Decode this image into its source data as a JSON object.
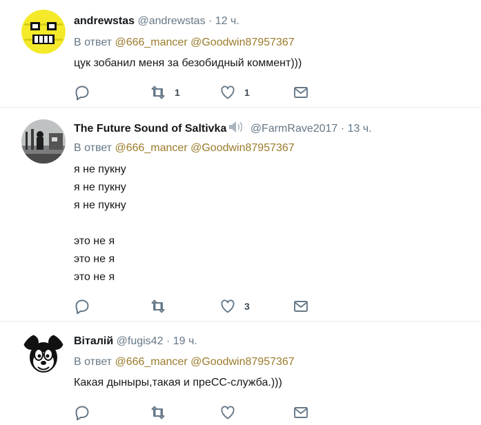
{
  "tweets": [
    {
      "name": "andrewstas",
      "handle": "@andrewstas",
      "time": "12 ч.",
      "reply_prefix": "В ответ",
      "mentions": [
        "@666_mancer",
        "@Goodwin87957367"
      ],
      "text": "цук зобанил меня за безобидный коммент)))",
      "retweets": "1",
      "likes": "1",
      "avatar": "smiley-avatar"
    },
    {
      "name": "The Future Sound of Saltivka",
      "handle": "@FarmRave2017",
      "time": "13 ч.",
      "reply_prefix": "В ответ",
      "mentions": [
        "@666_mancer",
        "@Goodwin87957367"
      ],
      "text": "я не пукну\nя не пукну\nя не пукну\n\nэто не я\nэто не я\nэто не я",
      "retweets": "",
      "likes": "3",
      "avatar": "photo-avatar",
      "name_icon": "speaker-icon"
    },
    {
      "name": "Віталій",
      "handle": "@fugis42",
      "time": "19 ч.",
      "reply_prefix": "В ответ",
      "mentions": [
        "@666_mancer",
        "@Goodwin87957367"
      ],
      "text": "Какая дыныры,такая и преСС-служба.)))",
      "retweets": "",
      "likes": "",
      "avatar": "mickey-avatar"
    }
  ],
  "icons": {
    "reply": "reply-icon",
    "retweet": "retweet-icon",
    "like": "heart-icon",
    "dm": "envelope-icon"
  },
  "colors": {
    "text": "#14171a",
    "secondary": "#657786",
    "mention": "#9b7a2a",
    "divider": "#e6ecf0"
  }
}
